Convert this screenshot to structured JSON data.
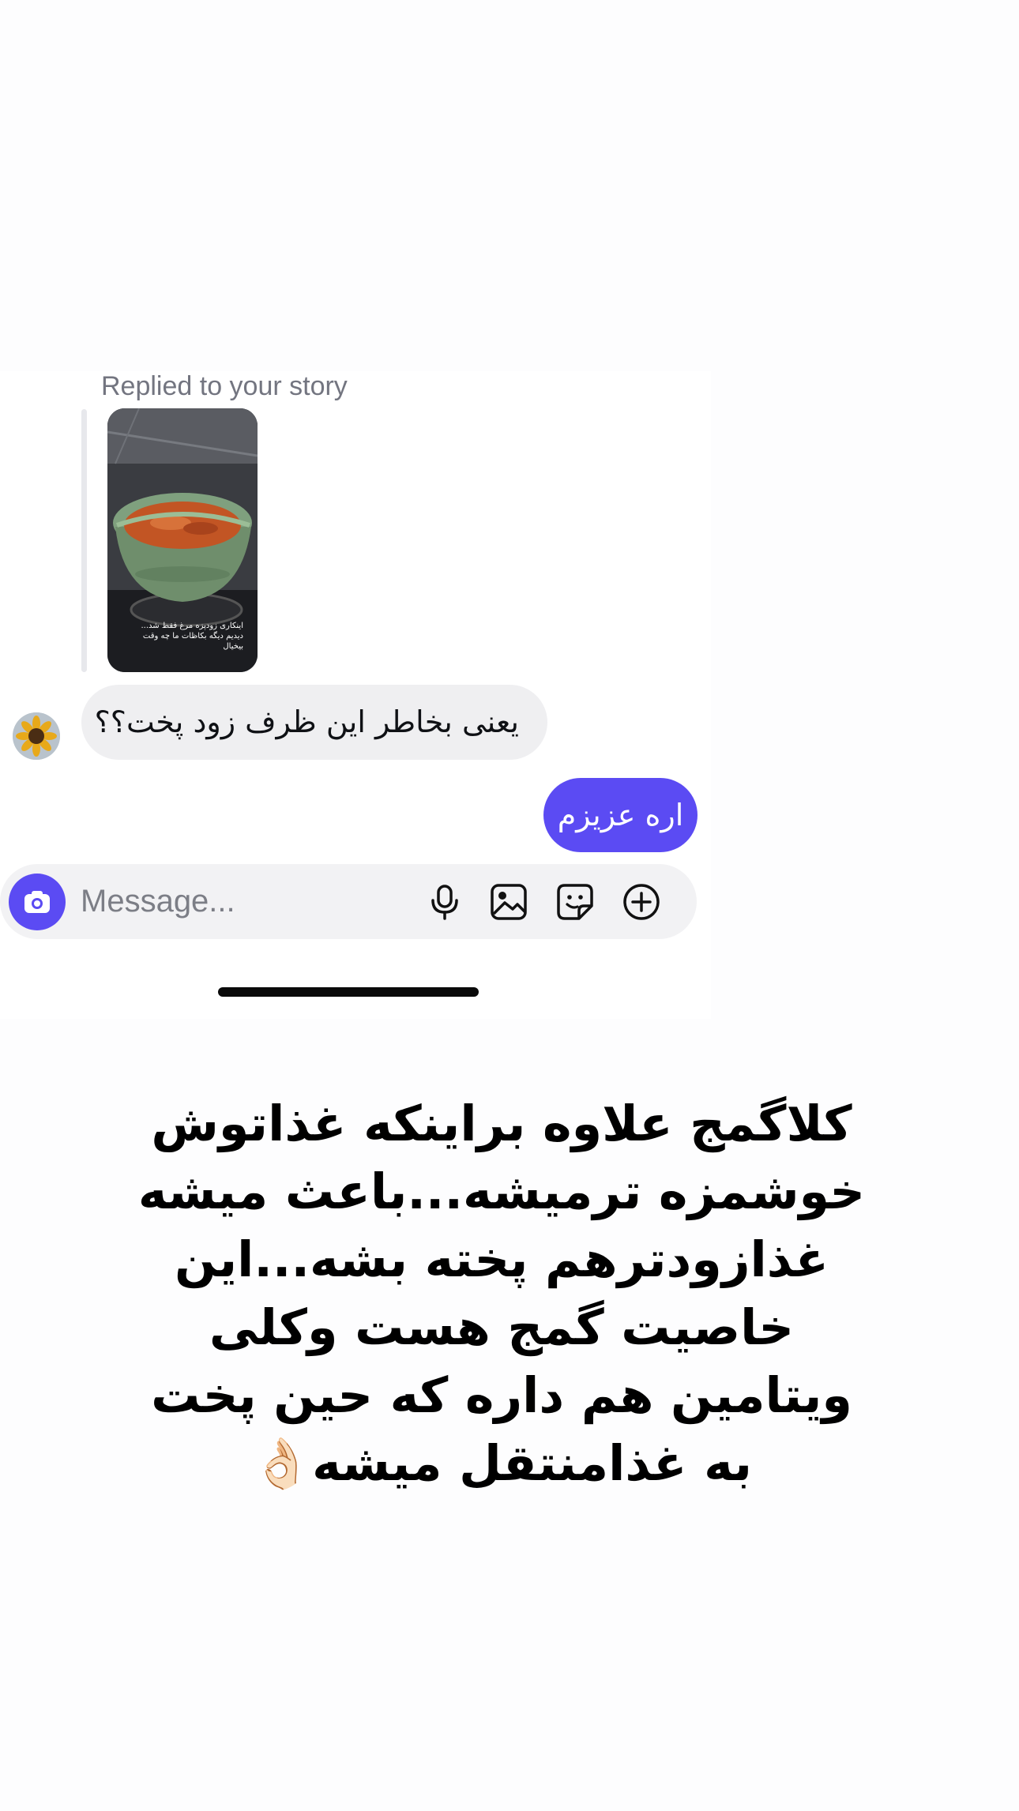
{
  "reply": {
    "label": "Replied to your story",
    "story_caption_line1": "اینکاری زودپزه مرغ فقط شد...",
    "story_caption_line2": "دیدیم دیگه بکاظات ما چه وقت بیخیال"
  },
  "messages": [
    {
      "direction": "incoming",
      "text": "یعنی بخاطر این ظرف زود پخت؟؟"
    },
    {
      "direction": "outgoing",
      "text": "اره عزیزم"
    }
  ],
  "composer": {
    "placeholder": "Message...",
    "icons": [
      "camera-icon",
      "microphone-icon",
      "gallery-icon",
      "sticker-icon",
      "plus-circle-icon"
    ]
  },
  "overlay": {
    "lines": [
      "کلاگمج علاوه براینکه غذاتوش",
      "خوشمزه ترمیشه...باعث میشه",
      "غذازودترهم پخته بشه...این",
      "خاصیت گمج هست وکلی",
      "ویتامین هم داره که حین پخت",
      "به غذامنتقل میشه👌🏻"
    ]
  },
  "colors": {
    "accent": "#5b4bf3",
    "incoming_bubble": "#efeff1",
    "composer_bg": "#f2f2f4",
    "muted_text": "#737580"
  }
}
